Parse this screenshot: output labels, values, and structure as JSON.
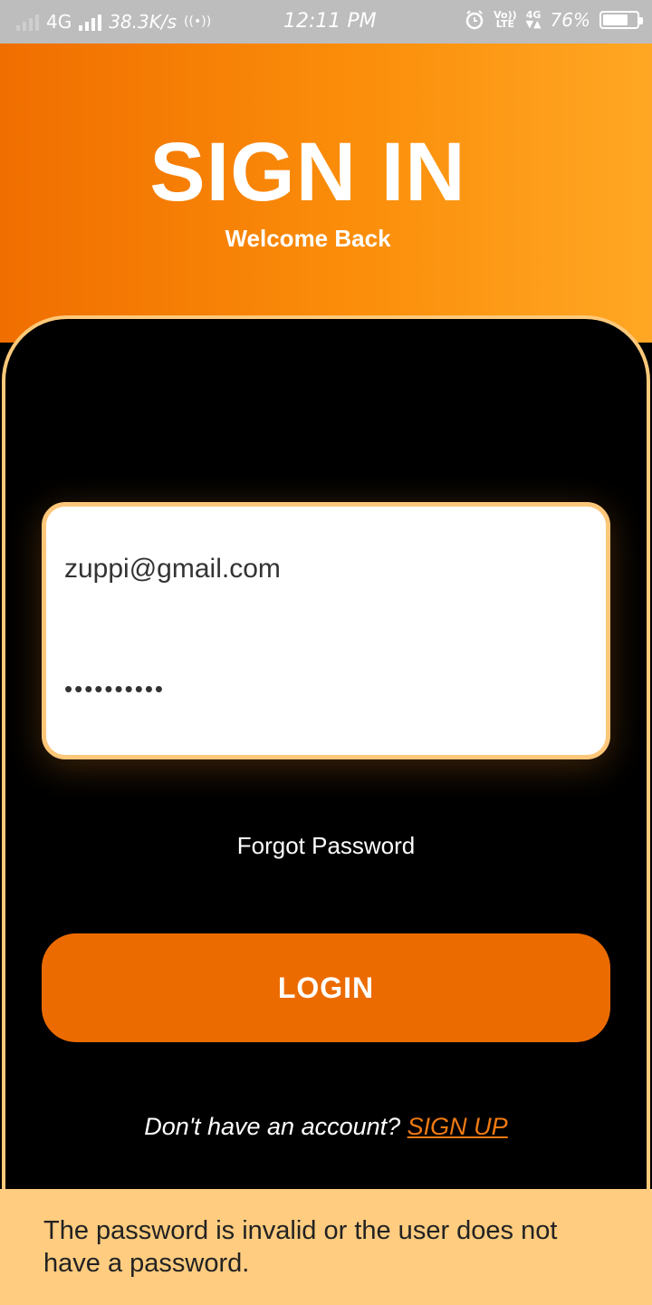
{
  "status_bar": {
    "network": "4G",
    "speed": "38.3K/s",
    "time": "12:11 PM",
    "volte_top": "Vo))",
    "volte_bottom": "LTE",
    "network2": "4G",
    "battery_percent": "76%",
    "battery_level": 0.76
  },
  "header": {
    "title": "SIGN IN",
    "subtitle": "Welcome Back"
  },
  "form": {
    "email_value": "zuppi@gmail.com",
    "password_value": "••••••••••"
  },
  "links": {
    "forgot_password": "Forgot Password",
    "no_account": "Don't have an account?",
    "sign_up": "SIGN UP"
  },
  "buttons": {
    "login": "LOGIN"
  },
  "error_message": "The password is invalid or the user does not have a password.",
  "colors": {
    "accent": "#ec6b00",
    "gradient_start": "#f06e00",
    "gradient_end": "#ffa724",
    "error_bg": "#ffcc80"
  }
}
